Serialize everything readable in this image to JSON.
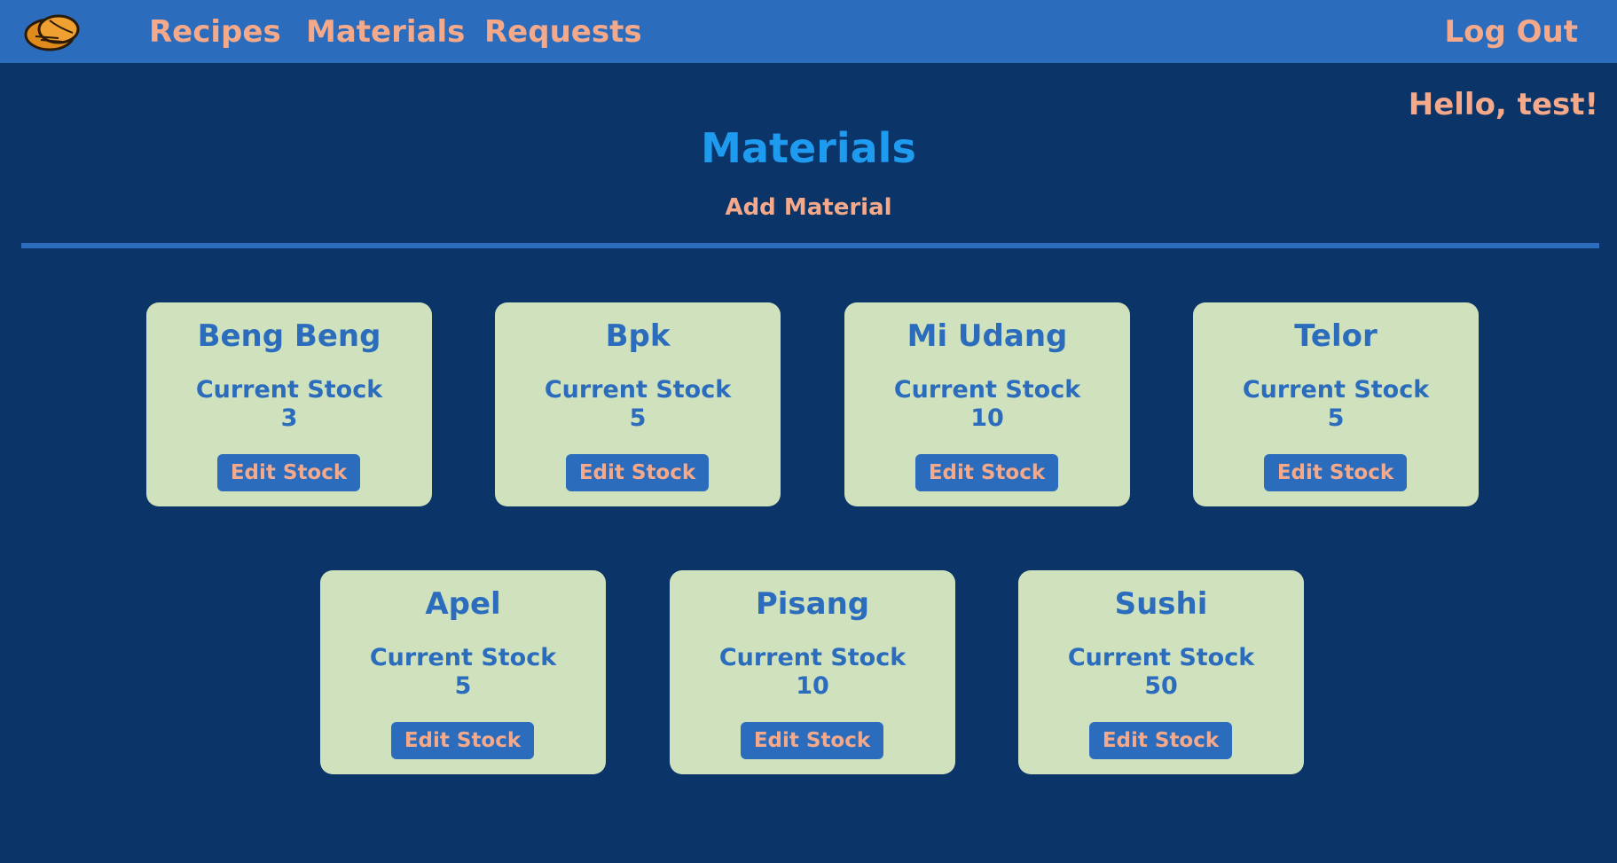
{
  "nav": {
    "logo_icon": "bread-logo-icon",
    "links": [
      {
        "label": "Recipes"
      },
      {
        "label": "Materials"
      },
      {
        "label": "Requests"
      }
    ],
    "logout_label": "Log Out"
  },
  "greeting": "Hello, test!",
  "page": {
    "title": "Materials",
    "add_label": "Add Material"
  },
  "stock_label": "Current Stock",
  "edit_label": "Edit Stock",
  "materials": [
    {
      "name": "Beng Beng",
      "stock": "3"
    },
    {
      "name": "Bpk",
      "stock": "5"
    },
    {
      "name": "Mi Udang",
      "stock": "10"
    },
    {
      "name": "Telor",
      "stock": "5"
    },
    {
      "name": "Apel",
      "stock": "5"
    },
    {
      "name": "Pisang",
      "stock": "10"
    },
    {
      "name": "Sushi",
      "stock": "50"
    }
  ],
  "colors": {
    "background": "#0b3468",
    "navbar": "#2b6cbd",
    "accent_text": "#f4a98a",
    "title": "#1e9aef",
    "card": "#cfe2bd",
    "card_text": "#2b6cbd"
  }
}
